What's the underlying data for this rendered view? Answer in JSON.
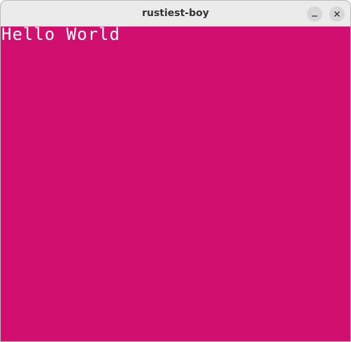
{
  "window": {
    "title": "rustiest-boy",
    "background_color": "#d10f6f",
    "controls": {
      "minimize_icon": "minimize-icon",
      "close_icon": "close-icon"
    }
  },
  "screen": {
    "text": "Hello World",
    "text_color": "#ffffff"
  }
}
